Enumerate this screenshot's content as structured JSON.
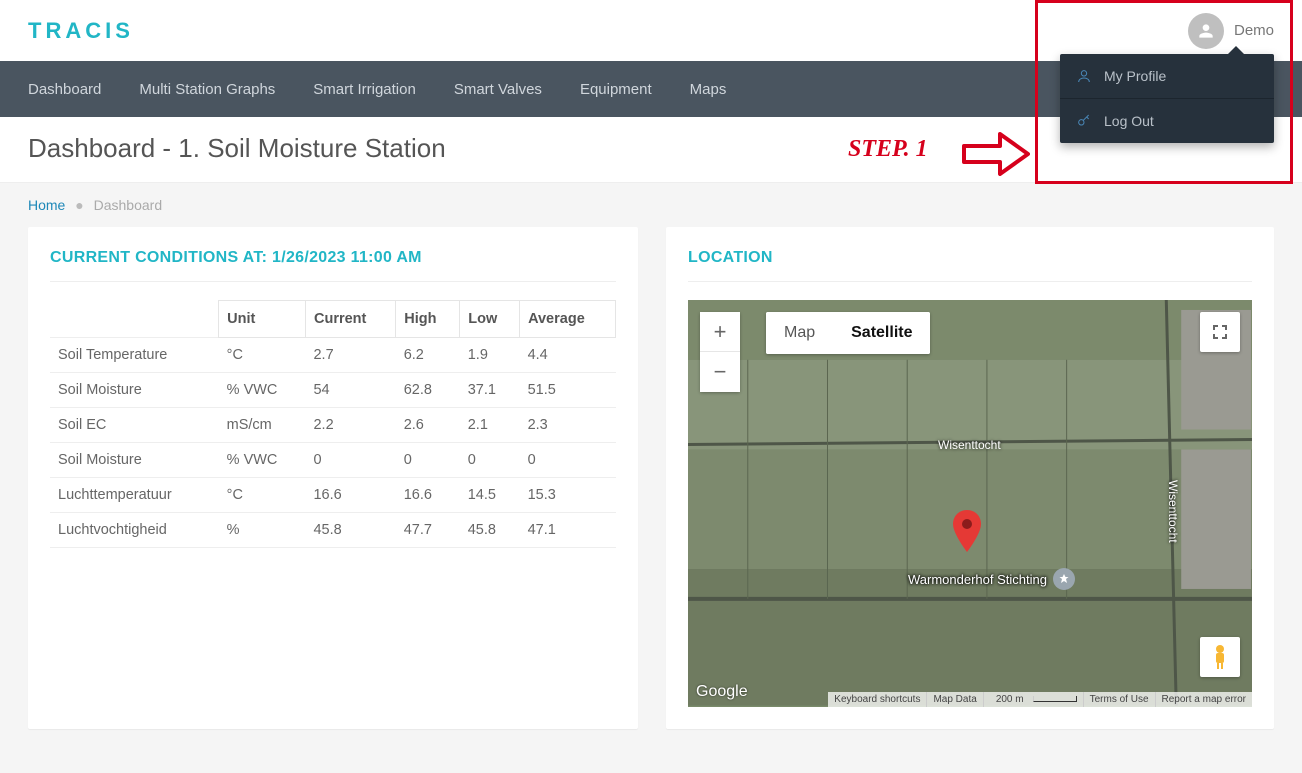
{
  "brand": "TRACIS",
  "user": {
    "name": "Demo"
  },
  "user_menu": {
    "profile": "My Profile",
    "logout": "Log Out"
  },
  "nav": {
    "items": [
      {
        "label": "Dashboard"
      },
      {
        "label": "Multi Station Graphs"
      },
      {
        "label": "Smart Irrigation"
      },
      {
        "label": "Smart Valves"
      },
      {
        "label": "Equipment"
      },
      {
        "label": "Maps"
      }
    ]
  },
  "page": {
    "title": "Dashboard - 1. Soil Moisture Station"
  },
  "breadcrumb": {
    "home": "Home",
    "current": "Dashboard"
  },
  "conditions": {
    "title": "CURRENT CONDITIONS AT: 1/26/2023 11:00 AM",
    "headers": [
      "",
      "Unit",
      "Current",
      "High",
      "Low",
      "Average"
    ],
    "rows": [
      {
        "name": "Soil Temperature",
        "unit": "°C",
        "current": "2.7",
        "high": "6.2",
        "low": "1.9",
        "avg": "4.4"
      },
      {
        "name": "Soil Moisture",
        "unit": "% VWC",
        "current": "54",
        "high": "62.8",
        "low": "37.1",
        "avg": "51.5"
      },
      {
        "name": "Soil EC",
        "unit": "mS/cm",
        "current": "2.2",
        "high": "2.6",
        "low": "2.1",
        "avg": "2.3"
      },
      {
        "name": "Soil Moisture",
        "unit": "% VWC",
        "current": "0",
        "high": "0",
        "low": "0",
        "avg": "0"
      },
      {
        "name": "Luchttemperatuur",
        "unit": "°C",
        "current": "16.6",
        "high": "16.6",
        "low": "14.5",
        "avg": "15.3"
      },
      {
        "name": "Luchtvochtigheid",
        "unit": "%",
        "current": "45.8",
        "high": "47.7",
        "low": "45.8",
        "avg": "47.1"
      }
    ]
  },
  "location": {
    "title": "LOCATION",
    "map_tab": "Map",
    "satellite_tab": "Satellite",
    "poi": "Warmonderhof Stichting",
    "road1": "Wisenttocht",
    "road2": "Wisenttocht",
    "google": "Google",
    "footer": {
      "shortcuts": "Keyboard shortcuts",
      "mapdata": "Map Data",
      "scale": "200 m",
      "terms": "Terms of Use",
      "report": "Report a map error"
    }
  },
  "annotation": {
    "step": "STEP. 1"
  }
}
